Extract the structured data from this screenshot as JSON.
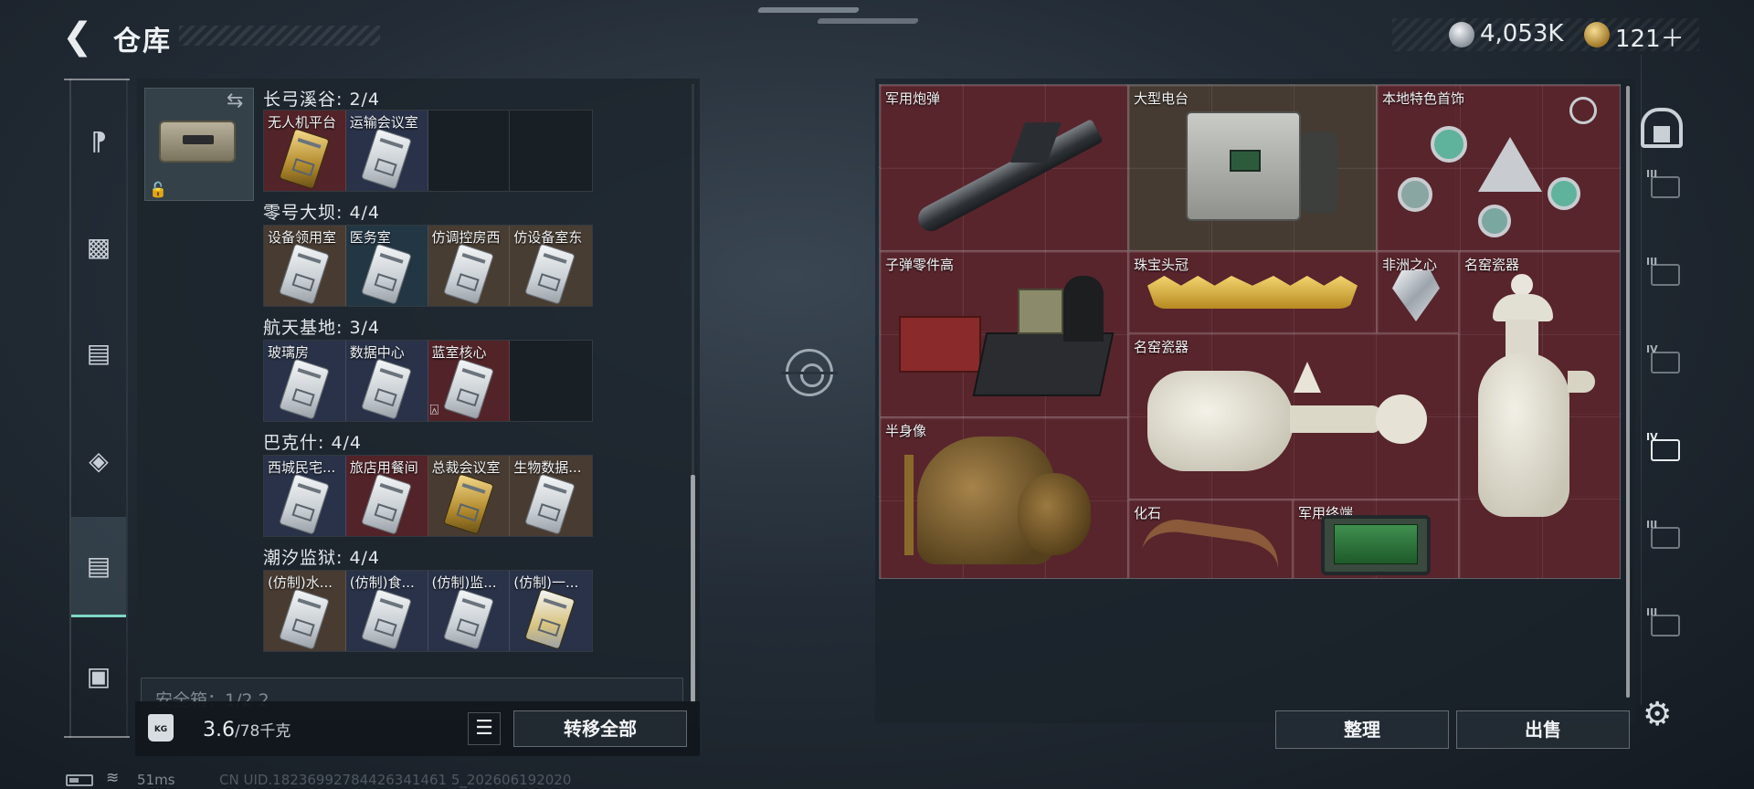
{
  "header": {
    "title": "仓库"
  },
  "currency": {
    "silver_value": "4,053K",
    "gold_value": "121＋"
  },
  "left_nav": {
    "items": [
      {
        "name": "nav-weapon",
        "glyph": "🔫"
      },
      {
        "name": "nav-armor",
        "glyph": "🦺"
      },
      {
        "name": "nav-backpack",
        "glyph": "🎒"
      },
      {
        "name": "nav-bag",
        "glyph": "👝"
      },
      {
        "name": "nav-keycard",
        "glyph": "🗂"
      },
      {
        "name": "nav-toolbox",
        "glyph": "🧰"
      }
    ]
  },
  "keycard_panel": {
    "sections": [
      {
        "title": "长弓溪谷: 2/4",
        "keys": [
          {
            "label": "无人机平台",
            "bg": "red",
            "gold": true
          },
          {
            "label": "运输会议室",
            "bg": "blue",
            "gold": false
          },
          {
            "label": "",
            "bg": "empty",
            "gold": false
          },
          {
            "label": "",
            "bg": "empty",
            "gold": false
          }
        ]
      },
      {
        "title": "零号大坝: 4/4",
        "keys": [
          {
            "label": "设备领用室",
            "bg": "brown",
            "gold": false
          },
          {
            "label": "医务室",
            "bg": "teal",
            "gold": false
          },
          {
            "label": "仿调控房西",
            "bg": "brown",
            "gold": false
          },
          {
            "label": "仿设备室东",
            "bg": "brown",
            "gold": false
          }
        ]
      },
      {
        "title": "航天基地: 3/4",
        "keys": [
          {
            "label": "玻璃房",
            "bg": "blue",
            "gold": false
          },
          {
            "label": "数据中心",
            "bg": "blue",
            "gold": false
          },
          {
            "label": "蓝室核心",
            "bg": "red",
            "gold": false
          },
          {
            "label": "",
            "bg": "empty",
            "gold": false
          }
        ]
      },
      {
        "title": "巴克什: 4/4",
        "keys": [
          {
            "label": "西城民宅...",
            "bg": "blue",
            "gold": false
          },
          {
            "label": "旅店用餐间",
            "bg": "red",
            "gold": false
          },
          {
            "label": "总裁会议室",
            "bg": "brown",
            "gold": true
          },
          {
            "label": "生物数据...",
            "bg": "brown",
            "gold": false
          }
        ]
      },
      {
        "title": "潮汐监狱: 4/4",
        "keys": [
          {
            "label": "(仿制)水...",
            "bg": "brown",
            "gold": false
          },
          {
            "label": "(仿制)食...",
            "bg": "blue",
            "gold": false
          },
          {
            "label": "(仿制)监...",
            "bg": "blue",
            "gold": false
          },
          {
            "label": "(仿制)一...",
            "bg": "blue",
            "gold": false
          }
        ]
      }
    ],
    "safe_box_label": "安全箱：1/2  2",
    "weight": "3.6",
    "weight_capacity": "/78千克",
    "weight_icon_text": "KG",
    "transfer_all_label": "转移全部"
  },
  "stash_items": [
    {
      "name": "military-shell",
      "label": "军用炮弹",
      "rarity": "red"
    },
    {
      "name": "large-radio",
      "label": "大型电台",
      "rarity": "brown"
    },
    {
      "name": "local-jewelry",
      "label": "本地特色首饰",
      "rarity": "red"
    },
    {
      "name": "bullet-parts",
      "label": "子弹零件高",
      "rarity": "red"
    },
    {
      "name": "jewel-crown",
      "label": "珠宝头冠",
      "rarity": "red"
    },
    {
      "name": "heart-of-africa",
      "label": "非洲之心",
      "rarity": "red"
    },
    {
      "name": "famous-kiln-porcelain-tall",
      "label": "名窑瓷器",
      "rarity": "red"
    },
    {
      "name": "famous-kiln-porcelain-wide",
      "label": "名窑瓷器",
      "rarity": "red"
    },
    {
      "name": "bust-statue",
      "label": "半身像",
      "rarity": "red"
    },
    {
      "name": "fossil",
      "label": "化石",
      "rarity": "red"
    },
    {
      "name": "military-terminal",
      "label": "军用终端",
      "rarity": "red"
    }
  ],
  "stash_actions": {
    "sort_label": "整理",
    "sell_label": "出售"
  },
  "right_nav": {
    "tiers": [
      "III",
      "III",
      "IV",
      "IV",
      "III",
      "III"
    ],
    "active_index": 3
  },
  "status_bar": {
    "ping": "51ms",
    "uid": "CN UID.18236992784426341461 5_202606192020"
  },
  "colors": {
    "accent": "#7fd6c6",
    "rarity_red": "#62242c",
    "rarity_gold": "#b38b2e"
  }
}
